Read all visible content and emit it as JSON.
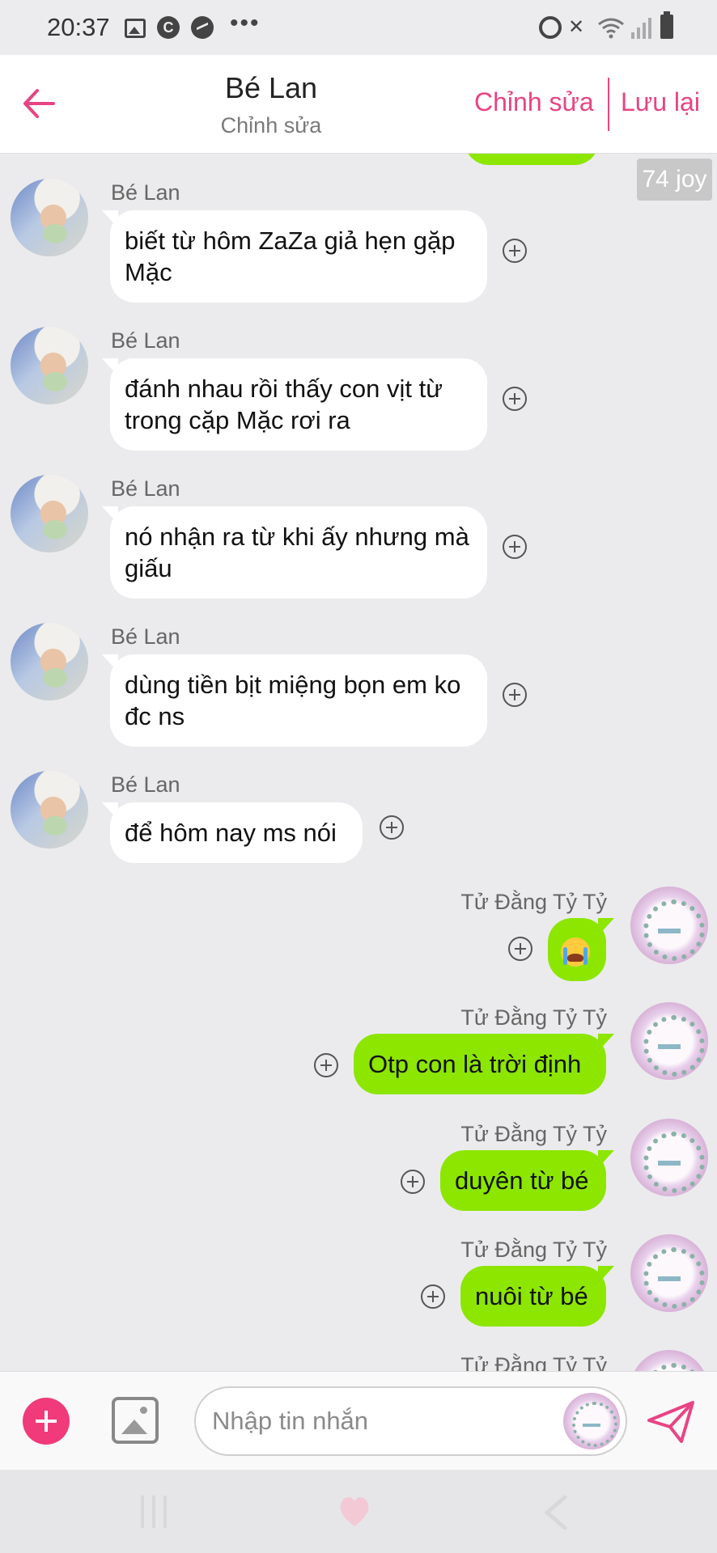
{
  "status_bar": {
    "time": "20:37",
    "left_icons": [
      "gallery-icon",
      "c-icon",
      "messenger-icon",
      "more-dots-icon"
    ],
    "dots": "•••",
    "right_icons": [
      "alarm-icon",
      "mute-icon",
      "wifi-icon",
      "signal-icon",
      "battery-icon"
    ]
  },
  "header": {
    "title": "Bé Lan",
    "subtitle": "Chỉnh sửa",
    "edit_label": "Chỉnh sửa",
    "save_label": "Lưu lại",
    "accent_color": "#e84484"
  },
  "chat": {
    "joy_badge": "74 joy",
    "incoming": [
      {
        "sender": "Bé Lan",
        "text": "biết từ hôm ZaZa giả hẹn gặp Mặc"
      },
      {
        "sender": "Bé Lan",
        "text": "đánh nhau rồi thấy con vịt từ trong cặp Mặc rơi ra"
      },
      {
        "sender": "Bé Lan",
        "text": "nó nhận ra từ khi ấy nhưng mà giấu"
      },
      {
        "sender": "Bé Lan",
        "text": "dùng tiền bịt miệng bọn em ko đc ns"
      },
      {
        "sender": "Bé Lan",
        "text": "để hôm nay ms nói"
      }
    ],
    "outgoing": [
      {
        "sender": "Tử Đằng Tỷ Tỷ",
        "text": "",
        "emoji": "crying-face-emoji"
      },
      {
        "sender": "Tử Đằng Tỷ Tỷ",
        "text": "Otp con là trời định"
      },
      {
        "sender": "Tử Đằng Tỷ Tỷ",
        "text": "duyên từ bé"
      },
      {
        "sender": "Tử Đằng Tỷ Tỷ",
        "text": "nuôi từ bé"
      },
      {
        "sender": "Tử Đằng Tỷ Tỷ",
        "text": ""
      }
    ],
    "outgoing_bubble_color": "#8ce600",
    "incoming_bubble_color": "#ffffff"
  },
  "composer": {
    "placeholder": "Nhập tin nhắn",
    "value": "",
    "add_color": "#f03a7a"
  },
  "nav": {
    "buttons": [
      "recents-icon",
      "home-heart-icon",
      "back-chevron-icon"
    ]
  }
}
